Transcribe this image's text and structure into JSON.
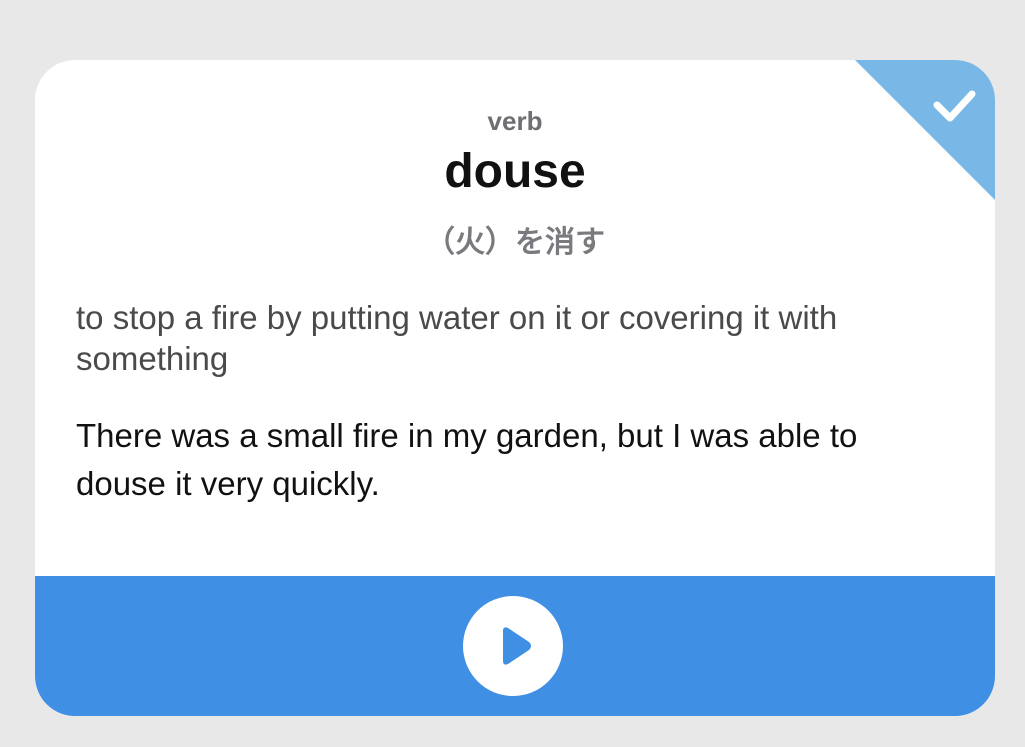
{
  "card": {
    "part_of_speech": "verb",
    "word": "douse",
    "translation": "（火）を消す",
    "definition": "to stop a fire by putting water on it or covering it with something",
    "example": "There was a small fire in my garden, but I was able to douse it very quickly."
  },
  "status": {
    "learned": true,
    "icon": "checkmark-icon",
    "color": "#79b8e6"
  },
  "footer": {
    "color": "#3f8fe5",
    "play_icon": "play-icon",
    "play_icon_color": "#3f8fe5"
  }
}
